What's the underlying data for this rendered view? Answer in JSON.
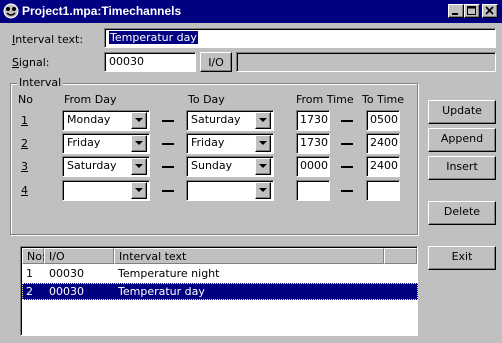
{
  "window": {
    "title": "Project1.mpa:Timechannels",
    "controls": [
      "minimize-icon",
      "maximize-icon",
      "close-icon"
    ]
  },
  "interval_text": {
    "label": "Interval text:",
    "value": "Temperatur day"
  },
  "signal": {
    "label": "Signal:",
    "value": "00030",
    "io_button": "I/O",
    "description": ""
  },
  "interval_group": {
    "legend": "Interval",
    "headers": {
      "no": "No",
      "from_day": "From Day",
      "to_day": "To Day",
      "from_time": "From Time",
      "to_time": "To Time"
    },
    "rows": [
      {
        "no": "1",
        "from_day": "Monday",
        "to_day": "Saturday",
        "from_time": "1730",
        "to_time": "0500"
      },
      {
        "no": "2",
        "from_day": "Friday",
        "to_day": "Friday",
        "from_time": "1730",
        "to_time": "2400"
      },
      {
        "no": "3",
        "from_day": "Saturday",
        "to_day": "Sunday",
        "from_time": "0000",
        "to_time": "2400"
      },
      {
        "no": "4",
        "from_day": "",
        "to_day": "",
        "from_time": "",
        "to_time": ""
      }
    ]
  },
  "buttons": {
    "update": "Update",
    "append": "Append",
    "insert": "Insert",
    "delete": "Delete",
    "exit": "Exit"
  },
  "list": {
    "columns": [
      "No:",
      "I/O",
      "Interval text"
    ],
    "rows": [
      {
        "no": "1",
        "io": "00030",
        "text": "Temperature night",
        "selected": false
      },
      {
        "no": "2",
        "io": "00030",
        "text": "Temperatur day",
        "selected": true
      }
    ]
  },
  "colors": {
    "title_bar": "#000080",
    "selection": "#000080",
    "face": "#c0c0c0"
  }
}
